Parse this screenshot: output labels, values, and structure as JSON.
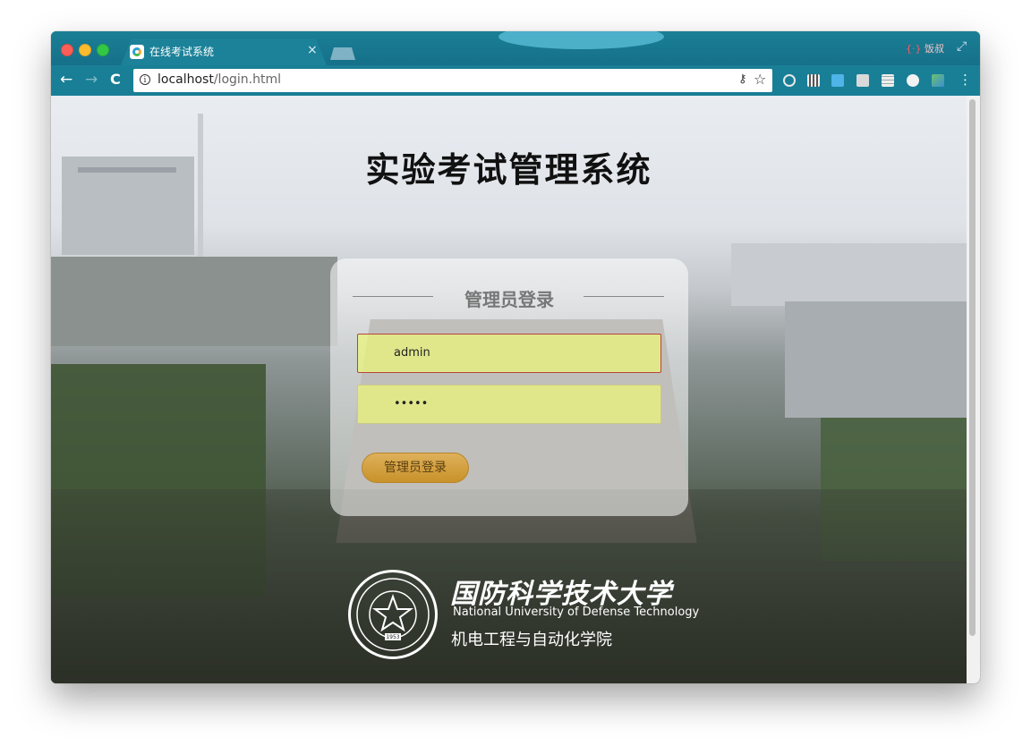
{
  "browser": {
    "tab_title": "在线考试系统",
    "tab_close": "×",
    "ext_label": "饭叔",
    "url_host": "localhost",
    "url_path": "/login.html",
    "back": "←",
    "forward": "→",
    "reload": "C",
    "menu": "⋮",
    "icons": [
      "info-icon",
      "key-icon",
      "star-icon",
      "opera-icon",
      "qr-icon",
      "translate-icon",
      "r-icon",
      "grid-icon",
      "circle-icon",
      "tag-icon"
    ]
  },
  "page": {
    "title": "实验考试管理系统",
    "login": {
      "heading": "管理员登录",
      "username_value": "admin",
      "password_value": "•••••",
      "submit_label": "管理员登录"
    },
    "footer": {
      "university_cn": "国防科学技术大学",
      "university_en": "National University of Defense Technology",
      "college": "机电工程与自动化学院",
      "emblem_year": "1953"
    }
  },
  "colors": {
    "chrome_bar": "#197f96",
    "input_fill": "#ecf678",
    "button_gold": "#d4a043"
  }
}
